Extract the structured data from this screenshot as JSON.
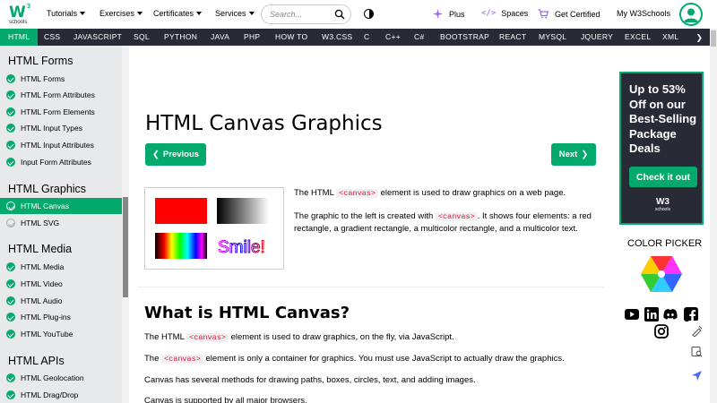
{
  "topbar": {
    "logo": {
      "w": "W",
      "sup": "3",
      "sub": "schools"
    },
    "menus": [
      "Tutorials",
      "Exercises",
      "Certificates",
      "Services"
    ],
    "search_placeholder": "Search...",
    "plus": "Plus",
    "spaces": "Spaces",
    "get_certified": "Get Certified",
    "my_w3schools": "My W3Schools"
  },
  "subnav": {
    "items": [
      "HTML",
      "CSS",
      "JAVASCRIPT",
      "SQL",
      "PYTHON",
      "JAVA",
      "PHP",
      "HOW TO",
      "W3.CSS",
      "C",
      "C++",
      "C#",
      "BOOTSTRAP",
      "REACT",
      "MYSQL",
      "JQUERY",
      "EXCEL",
      "XML"
    ],
    "active": "HTML"
  },
  "sidebar": {
    "sections": [
      {
        "title": "HTML Forms",
        "items": [
          "HTML Forms",
          "HTML Form Attributes",
          "HTML Form Elements",
          "HTML Input Types",
          "HTML Input Attributes",
          "Input Form Attributes"
        ]
      },
      {
        "title": "HTML Graphics",
        "items": [
          "HTML Canvas",
          "HTML SVG"
        ]
      },
      {
        "title": "HTML Media",
        "items": [
          "HTML Media",
          "HTML Video",
          "HTML Audio",
          "HTML Plug-ins",
          "HTML YouTube"
        ]
      },
      {
        "title": "HTML APIs",
        "items": [
          "HTML Geolocation",
          "HTML Drag/Drop"
        ]
      }
    ],
    "active_item": "HTML Canvas"
  },
  "main": {
    "title": "HTML Canvas Graphics",
    "prev_label": "Previous",
    "next_label": "Next",
    "intro1": {
      "pre": "The HTML",
      "code": "<canvas>",
      "post": "element is used to draw graphics on a web page."
    },
    "intro2": {
      "pre": "The graphic to the left is created with",
      "code": "<canvas>",
      "post": ". It shows four elements: a red rectangle, a gradient rectangle, a multicolor rectangle, and a multicolor text."
    },
    "canvas_text": "Smile!",
    "h2": "What is HTML Canvas?",
    "p1": {
      "pre": "The HTML",
      "code": "<canvas>",
      "post": "element is used to draw graphics, on the fly, via JavaScript."
    },
    "p2": {
      "pre": "The",
      "code": "<canvas>",
      "post": "element is only a container for graphics. You must use JavaScript to actually draw the graphics."
    },
    "p3": "Canvas has several methods for drawing paths, boxes, circles, text, and adding images.",
    "p4": "Canvas is supported by all major browsers."
  },
  "rail": {
    "ad_text": "Up to 53% Off on our Best-Selling Package Deals",
    "ad_cta": "Check it out",
    "ad_logo": "W3",
    "ad_logo_sub": "schools",
    "color_picker": "COLOR PICKER"
  },
  "colors": {
    "brand_green": "#04AA6D",
    "dark": "#282A35",
    "code_red": "#DC143C",
    "plus_purple": "#9763f6"
  }
}
